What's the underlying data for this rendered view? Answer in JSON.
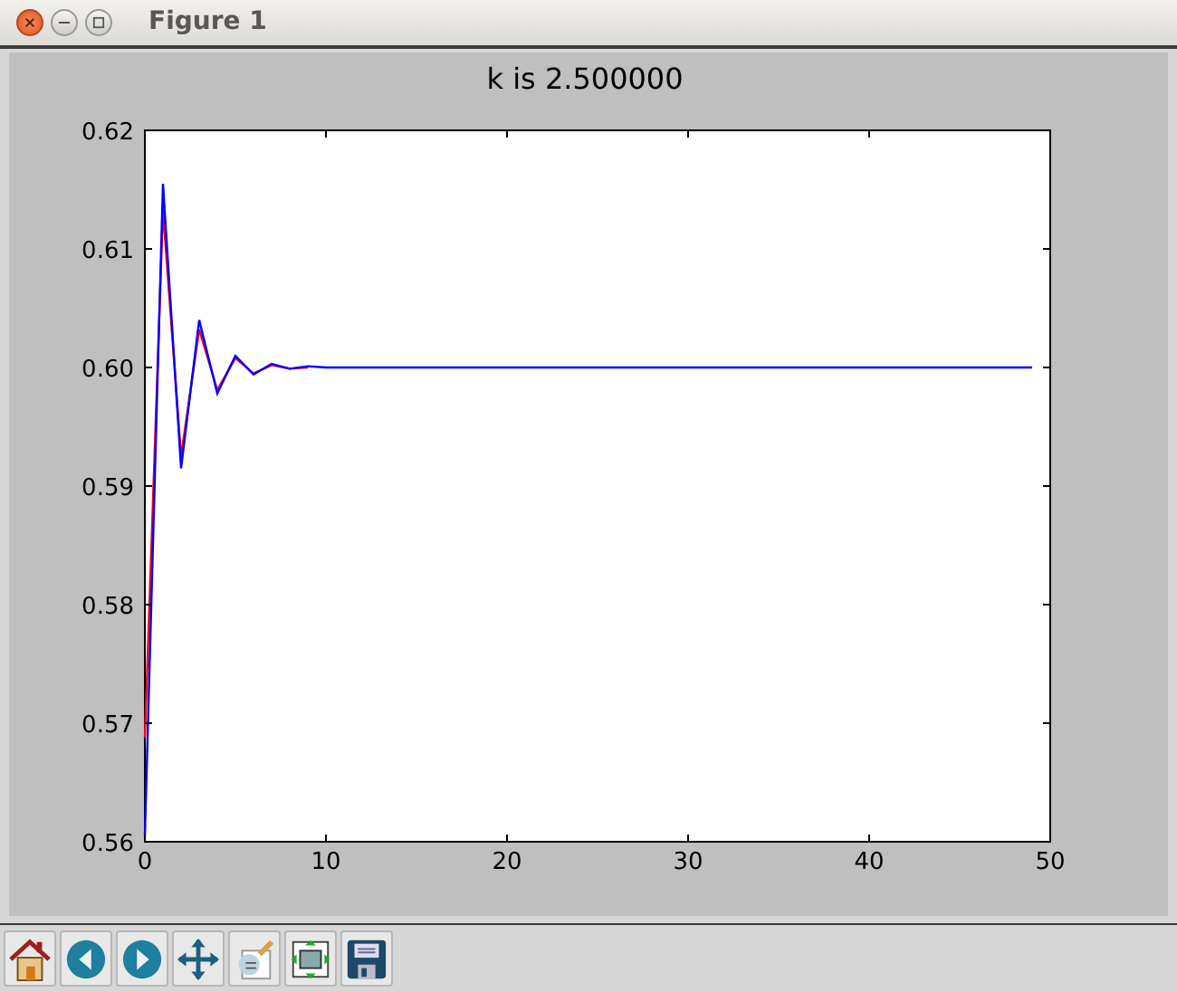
{
  "window": {
    "title": "Figure 1"
  },
  "figure": {
    "chart_data": {
      "type": "line",
      "title": "k is 2.500000",
      "x": [
        0,
        1,
        2,
        3,
        4,
        5,
        6,
        7,
        8,
        9,
        10,
        11,
        12,
        13,
        14,
        15,
        16,
        17,
        18,
        19,
        20,
        21,
        22,
        23,
        24,
        25,
        26,
        27,
        28,
        29,
        30,
        31,
        32,
        33,
        34,
        35,
        36,
        37,
        38,
        39,
        40,
        41,
        42,
        43,
        44,
        45,
        46,
        47,
        48,
        49
      ],
      "series": [
        {
          "color": "#ff0000",
          "values": [
            0.5688,
            0.6133,
            0.5925,
            0.6032,
            0.5981,
            0.6008,
            0.5995,
            0.6002,
            0.5999,
            0.6,
            null,
            null,
            null,
            null,
            null,
            null,
            null,
            null,
            null,
            null,
            null,
            null,
            null,
            null,
            null,
            null,
            null,
            null,
            null,
            null,
            null,
            null,
            null,
            null,
            null,
            null,
            null,
            null,
            null,
            null,
            null,
            null,
            null,
            null,
            null,
            null,
            null,
            null,
            null,
            null
          ]
        },
        {
          "color": "#0000ff",
          "values": [
            0.5605,
            0.6155,
            0.5915,
            0.604,
            0.5978,
            0.601,
            0.5994,
            0.6003,
            0.5999,
            0.6001,
            0.6,
            0.6,
            0.6,
            0.6,
            0.6,
            0.6,
            0.6,
            0.6,
            0.6,
            0.6,
            0.6,
            0.6,
            0.6,
            0.6,
            0.6,
            0.6,
            0.6,
            0.6,
            0.6,
            0.6,
            0.6,
            0.6,
            0.6,
            0.6,
            0.6,
            0.6,
            0.6,
            0.6,
            0.6,
            0.6,
            0.6,
            0.6,
            0.6,
            0.6,
            0.6,
            0.6,
            0.6,
            0.6,
            0.6,
            0.6
          ]
        }
      ],
      "xlim": [
        0,
        50
      ],
      "ylim": [
        0.56,
        0.62
      ],
      "xticks": [
        {
          "value": 0,
          "label": "0"
        },
        {
          "value": 10,
          "label": "10"
        },
        {
          "value": 20,
          "label": "20"
        },
        {
          "value": 30,
          "label": "30"
        },
        {
          "value": 40,
          "label": "40"
        },
        {
          "value": 50,
          "label": "50"
        }
      ],
      "yticks": [
        {
          "value": 0.56,
          "label": "0.56"
        },
        {
          "value": 0.57,
          "label": "0.57"
        },
        {
          "value": 0.58,
          "label": "0.58"
        },
        {
          "value": 0.59,
          "label": "0.59"
        },
        {
          "value": 0.6,
          "label": "0.60"
        },
        {
          "value": 0.61,
          "label": "0.61"
        },
        {
          "value": 0.62,
          "label": "0.62"
        }
      ]
    }
  },
  "toolbar": [
    {
      "kind": "home"
    },
    {
      "kind": "back"
    },
    {
      "kind": "forward"
    },
    {
      "kind": "pan"
    },
    {
      "kind": "edit"
    },
    {
      "kind": "subplots"
    },
    {
      "kind": "save"
    }
  ]
}
